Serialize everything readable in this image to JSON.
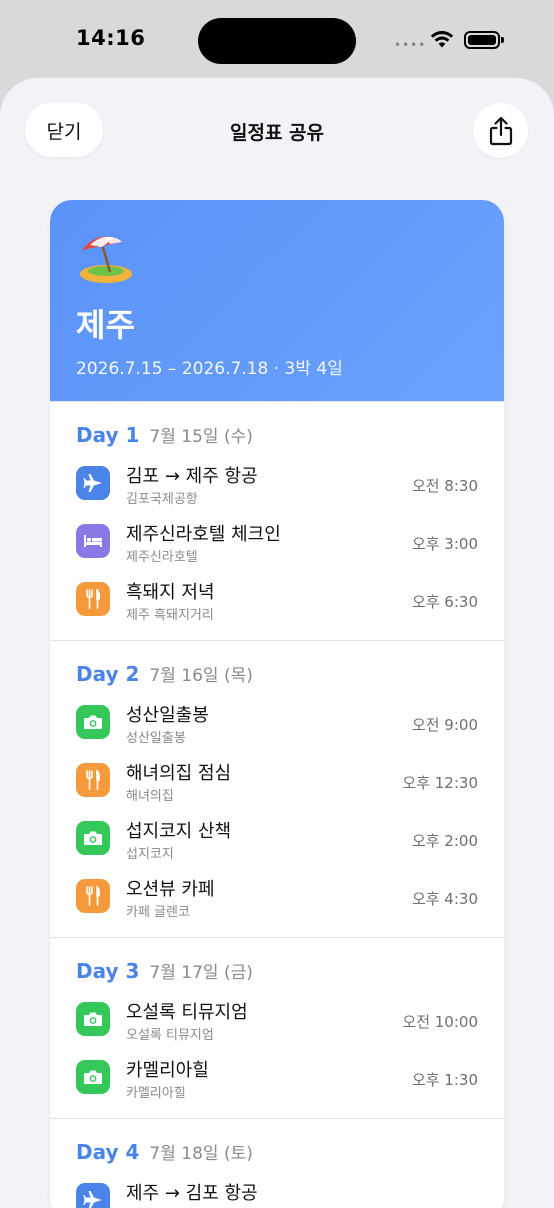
{
  "status": {
    "time": "14:16"
  },
  "header": {
    "close_label": "닫기",
    "title": "일정표 공유"
  },
  "trip": {
    "emoji": "beach-umbrella-island",
    "title": "제주",
    "dates": "2026.7.15 – 2026.7.18 · 3박 4일"
  },
  "colors": {
    "accent": "#4a84e8",
    "hero": "#5b92f9",
    "flight": "#4a84e8",
    "hotel": "#8b78e6",
    "food": "#f59a3c",
    "sight": "#34c759"
  },
  "days": [
    {
      "label": "Day 1",
      "date": "7월 15일 (수)",
      "items": [
        {
          "icon": "airplane-icon",
          "title": "김포 → 제주 항공",
          "subtitle": "김포국제공항",
          "time": "오전 8:30"
        },
        {
          "icon": "bed-icon",
          "title": "제주신라호텔 체크인",
          "subtitle": "제주신라호텔",
          "time": "오후 3:00"
        },
        {
          "icon": "fork-knife-icon",
          "title": "흑돼지 저녁",
          "subtitle": "제주 흑돼지거리",
          "time": "오후 6:30"
        }
      ]
    },
    {
      "label": "Day 2",
      "date": "7월 16일 (목)",
      "items": [
        {
          "icon": "camera-icon",
          "title": "성산일출봉",
          "subtitle": "성산일출봉",
          "time": "오전 9:00"
        },
        {
          "icon": "fork-knife-icon",
          "title": "해녀의집 점심",
          "subtitle": "해녀의집",
          "time": "오후 12:30"
        },
        {
          "icon": "camera-icon",
          "title": "섭지코지 산책",
          "subtitle": "섭지코지",
          "time": "오후 2:00"
        },
        {
          "icon": "fork-knife-icon",
          "title": "오션뷰 카페",
          "subtitle": "카페 글렌코",
          "time": "오후 4:30"
        }
      ]
    },
    {
      "label": "Day 3",
      "date": "7월 17일 (금)",
      "items": [
        {
          "icon": "camera-icon",
          "title": "오설록 티뮤지엄",
          "subtitle": "오설록 티뮤지엄",
          "time": "오전 10:00"
        },
        {
          "icon": "camera-icon",
          "title": "카멜리아힐",
          "subtitle": "카멜리아힐",
          "time": "오후 1:30"
        }
      ]
    },
    {
      "label": "Day 4",
      "date": "7월 18일 (토)",
      "items": [
        {
          "icon": "airplane-icon",
          "title": "제주 → 김포 항공",
          "subtitle": "",
          "time": ""
        }
      ]
    }
  ]
}
